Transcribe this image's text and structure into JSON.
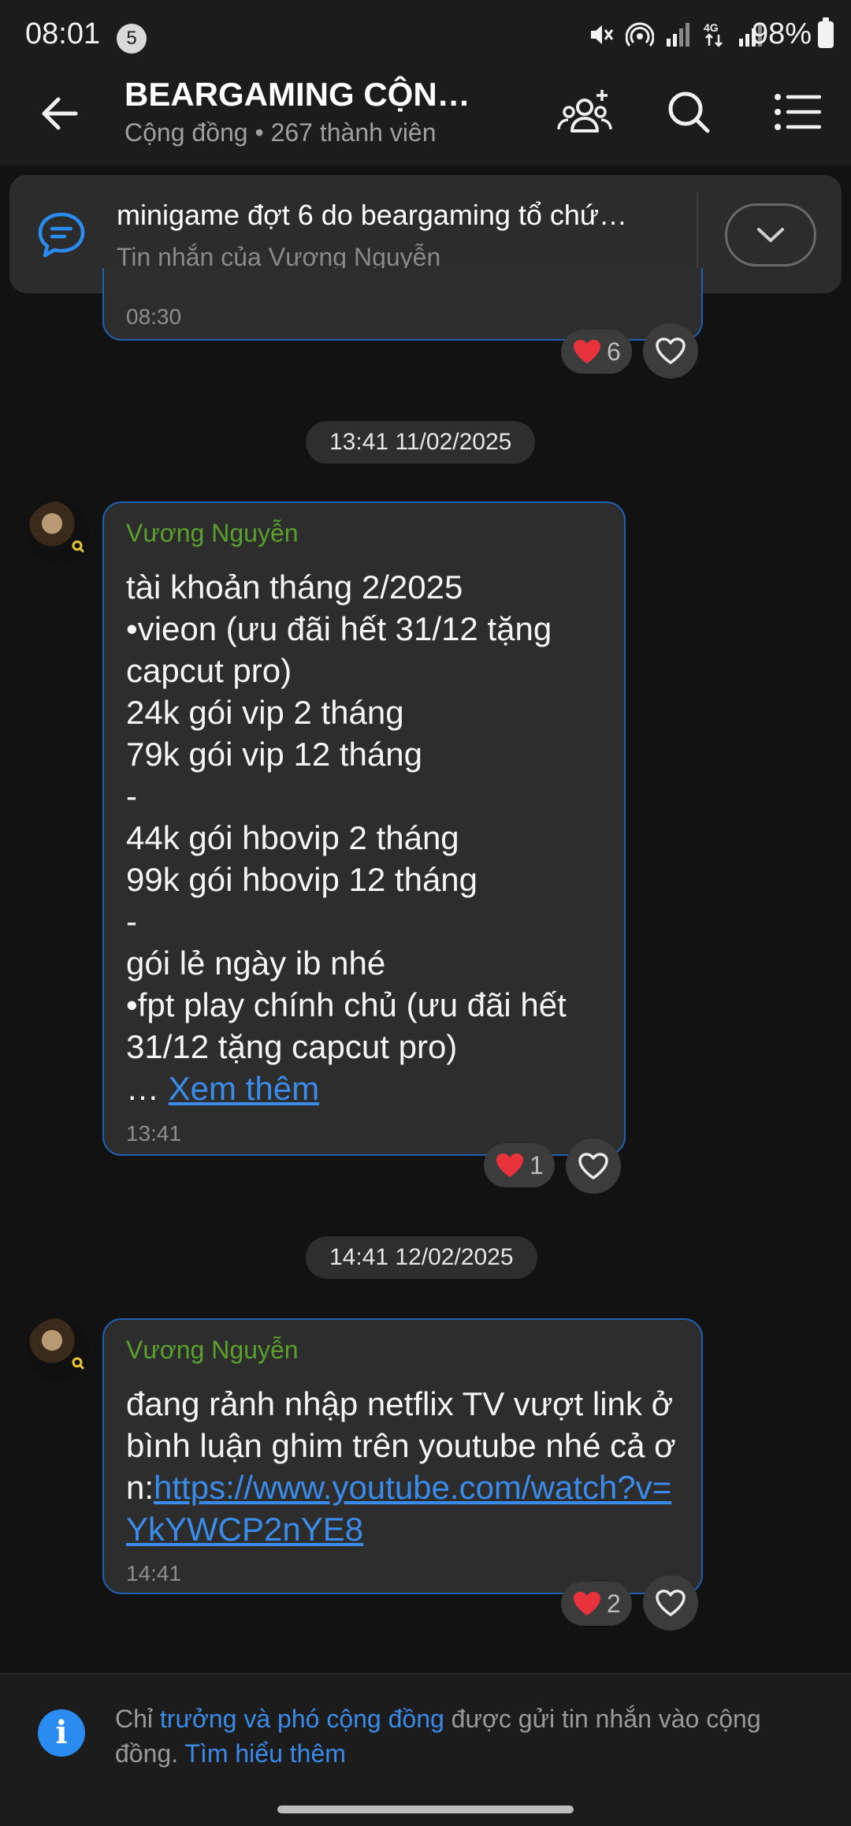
{
  "status_bar": {
    "time": "08:01",
    "notification_count": "5",
    "battery": "98%"
  },
  "header": {
    "title": "BEARGAMING CỘNG…",
    "subtitle": "Cộng đồng • 267 thành viên"
  },
  "pinned": {
    "title": "minigame đợt 6 do beargaming tổ chứ…",
    "subtitle": "Tin nhắn của Vương Nguyễn"
  },
  "messages": [
    {
      "time": "08:30",
      "reaction_count": "6"
    },
    {
      "date": "13:41 11/02/2025",
      "sender": "Vương Nguyễn",
      "text": "tài khoản tháng 2/2025\n•vieon (ưu đãi hết 31/12 tặng capcut pro)\n24k gói vip 2 tháng\n79k gói vip 12 tháng\n-\n44k gói hbovip 2 tháng\n99k gói hbovip 12 tháng\n-\ngói lẻ ngày ib nhé\n•fpt play chính chủ (ưu đãi hết 31/12 tặng capcut pro)",
      "ellipsis": "… ",
      "see_more": "Xem thêm",
      "time": "13:41",
      "reaction_count": "1"
    },
    {
      "date": "14:41 12/02/2025",
      "sender": "Vương Nguyễn",
      "text": "đang rảnh nhập netflix TV vượt link ở bình luận ghim trên youtube nhé cả ơn:",
      "link": "https://www.youtube.com/watch?v=YkYWCP2nYE8",
      "time": "14:41",
      "reaction_count": "2"
    }
  ],
  "footer": {
    "prefix": "Chỉ ",
    "highlight": "trưởng và phó cộng đồng",
    "middle": " được gửi tin nhắn vào cộng đồng. ",
    "learn_more": "Tìm hiểu thêm"
  },
  "colors": {
    "accent": "#3b8bea",
    "sender": "#5aa02c",
    "bubble_border": "#1f5fb0",
    "heart": "#e8323c"
  },
  "icons": [
    "back-arrow-icon",
    "add-member-icon",
    "search-icon",
    "menu-list-icon",
    "pinned-message-icon",
    "chevron-down-icon",
    "heart-icon",
    "heart-outline-icon",
    "info-icon",
    "key-icon"
  ]
}
